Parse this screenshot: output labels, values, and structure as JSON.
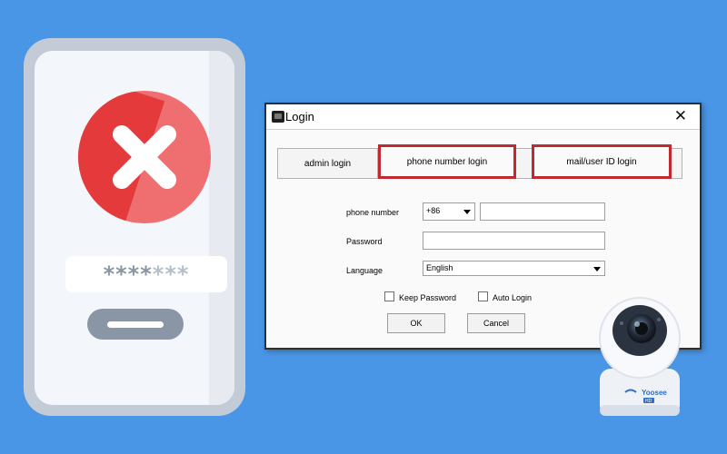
{
  "illustration": {
    "password_mask_dark": "****",
    "password_mask_light": "***",
    "error_color": "#e53a3c"
  },
  "dialog": {
    "title": "Login",
    "close_glyph": "✕",
    "tabs": [
      {
        "label": "admin login",
        "highlighted": false
      },
      {
        "label": "phone number login",
        "highlighted": true
      },
      {
        "label": "mail/user ID login",
        "highlighted": true
      }
    ],
    "phone": {
      "label": "phone number",
      "country_code": "+86",
      "value": ""
    },
    "password": {
      "label": "Password",
      "value": ""
    },
    "language": {
      "label": "Language",
      "selected": "English"
    },
    "keep_password": {
      "label": "Keep Password",
      "checked": false
    },
    "auto_login": {
      "label": "Auto Login",
      "checked": false
    },
    "ok_label": "OK",
    "cancel_label": "Cancel",
    "highlight_color": "#c0292f"
  },
  "camera": {
    "badge_brand": "Yoosee",
    "badge_sub": "HD"
  }
}
